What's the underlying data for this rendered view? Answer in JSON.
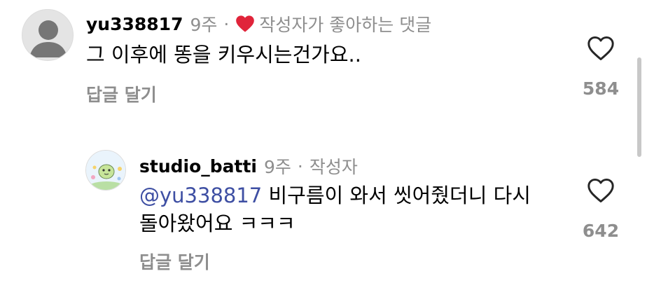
{
  "comments": [
    {
      "username": "yu338817",
      "time": "9주",
      "separator": "·",
      "creator_liked": "작성자가 좋아하는 댓글",
      "text": "그 이후에 똥을 키우시는건가요..",
      "reply_label": "답글 달기",
      "like_count": "584"
    },
    {
      "username": "studio_batti",
      "time": "9주",
      "separator": "·",
      "author_badge": "작성자",
      "mention": "@yu338817",
      "text_line1": " 비구름이 와서 씻어줬더니 다시",
      "text_line2": "돌아왔어요 ㅋㅋㅋ",
      "reply_label": "답글 달기",
      "like_count": "642"
    }
  ],
  "icons": {
    "avatar_default": "default-avatar-icon",
    "like": "heart-outline-icon",
    "creator_liked": "heart-filled-icon"
  },
  "colors": {
    "creator_heart": "#e0243a",
    "mention": "#3e4fa3",
    "secondary_text": "#8e8e8e"
  }
}
